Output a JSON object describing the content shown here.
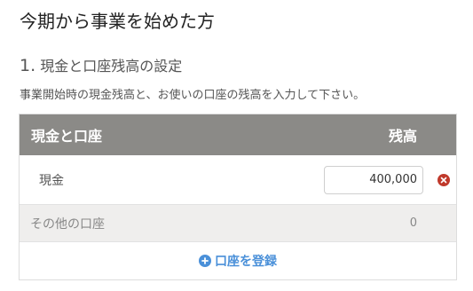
{
  "page": {
    "title": "今期から事業を始めた方"
  },
  "section": {
    "number": "1.",
    "title": "現金と口座残高の設定",
    "instructions": "事業開始時の現金残高と、お使いの口座の残高を入力して下さい。"
  },
  "table": {
    "headers": {
      "account": "現金と口座",
      "balance": "残高"
    },
    "cash_row": {
      "label": "現金",
      "value": "400,000"
    },
    "other_row": {
      "label": "その他の口座",
      "value": "0"
    },
    "register_label": "口座を登録"
  },
  "icons": {
    "remove": "remove-circle-icon",
    "add": "plus-circle-icon"
  },
  "colors": {
    "header_bg": "#8b8a87",
    "link": "#4a90d9",
    "remove": "#c0392b",
    "other_row_bg": "#efeeed"
  }
}
